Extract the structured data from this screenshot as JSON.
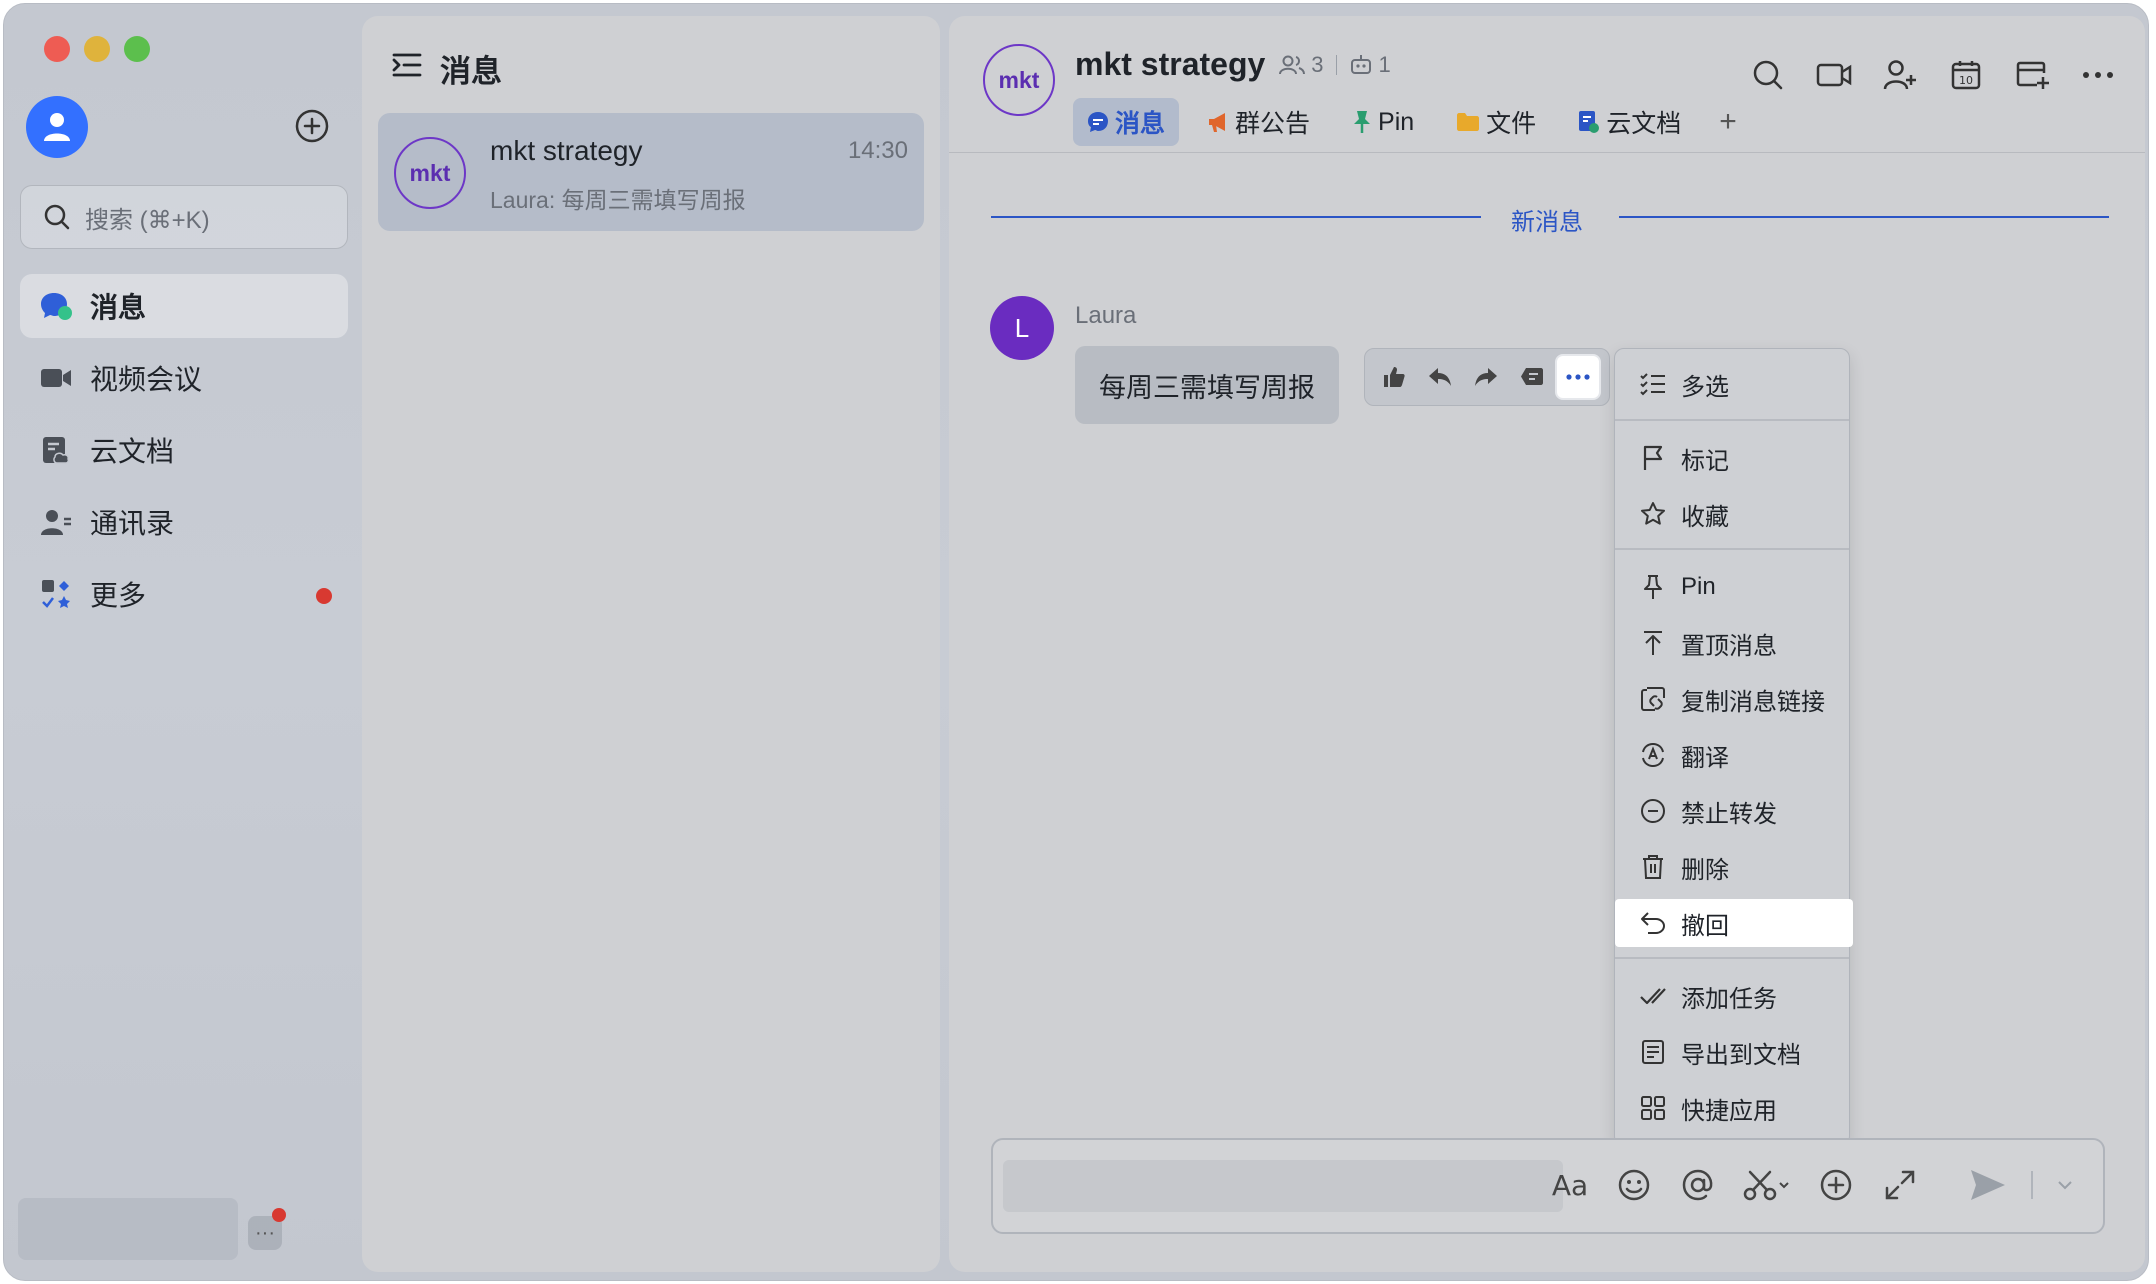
{
  "sidebar": {
    "search_placeholder": "搜索 (⌘+K)",
    "items": [
      {
        "label": "消息",
        "icon": "chat-bubble-icon",
        "active": true
      },
      {
        "label": "视频会议",
        "icon": "video-camera-icon"
      },
      {
        "label": "云文档",
        "icon": "cloud-docs-icon"
      },
      {
        "label": "通讯录",
        "icon": "contacts-icon"
      },
      {
        "label": "更多",
        "icon": "apps-grid-icon",
        "badge": "red-dot"
      }
    ]
  },
  "chatlist": {
    "title": "消息",
    "chats": [
      {
        "avatar_text": "mkt",
        "name": "mkt strategy",
        "time": "14:30",
        "preview": "Laura: 每周三需填写周报"
      }
    ]
  },
  "chat": {
    "avatar_text": "mkt",
    "name": "mkt strategy",
    "member_count": "3",
    "bot_count": "1",
    "tabs": [
      {
        "label": "消息",
        "icon": "chat-bubble-icon",
        "active": true
      },
      {
        "label": "群公告",
        "icon": "megaphone-icon"
      },
      {
        "label": "Pin",
        "icon": "pin-icon"
      },
      {
        "label": "文件",
        "icon": "folder-icon"
      },
      {
        "label": "云文档",
        "icon": "cloud-docs-icon"
      }
    ],
    "tab_add": "+",
    "new_messages_divider": "新消息",
    "message": {
      "sender_initial": "L",
      "sender": "Laura",
      "text": "每周三需填写周报"
    }
  },
  "context_menu": {
    "items": [
      {
        "label": "多选",
        "icon": "multi-select-icon"
      },
      {
        "label": "标记",
        "icon": "flag-icon"
      },
      {
        "label": "收藏",
        "icon": "star-icon"
      },
      {
        "label": "Pin",
        "icon": "pin-icon"
      },
      {
        "label": "置顶消息",
        "icon": "pin-to-top-icon"
      },
      {
        "label": "复制消息链接",
        "icon": "copy-link-icon"
      },
      {
        "label": "翻译",
        "icon": "translate-icon"
      },
      {
        "label": "禁止转发",
        "icon": "forbid-forward-icon"
      },
      {
        "label": "删除",
        "icon": "trash-icon"
      },
      {
        "label": "撤回",
        "icon": "recall-icon",
        "highlighted": true
      },
      {
        "label": "添加任务",
        "icon": "add-task-icon"
      },
      {
        "label": "导出到文档",
        "icon": "export-doc-icon"
      },
      {
        "label": "快捷应用",
        "icon": "quick-apps-icon"
      }
    ]
  },
  "composer": {
    "format_label": "Aa"
  },
  "colors": {
    "accent": "#2b55c5",
    "group_avatar": "#6d37c7",
    "sender_avatar": "#6a2cc0",
    "badge": "#d83931"
  }
}
